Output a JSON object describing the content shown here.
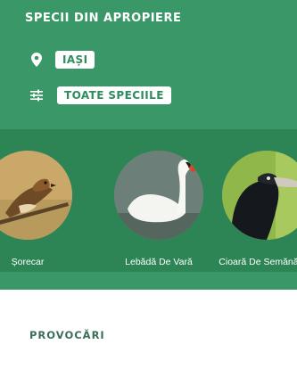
{
  "header": {
    "title": "SPECII DIN APROPIERE",
    "location": {
      "icon": "location-pin-icon",
      "label": "IAȘI"
    },
    "filter": {
      "icon": "sliders-filter-icon",
      "label": "TOATE SPECIILE"
    }
  },
  "species": [
    {
      "name": "Șorecar",
      "icon": "buzzard-photo"
    },
    {
      "name": "Lebădă De Vară",
      "icon": "swan-photo"
    },
    {
      "name": "Cioară De Semănătură",
      "icon": "rook-photo"
    }
  ],
  "sections": {
    "challenges_title": "PROVOCĂRI"
  },
  "colors": {
    "header_bg": "#3a9868",
    "band_bg": "#2d8555",
    "chip_text": "#2f8c5c",
    "section_title": "#3a6e58"
  }
}
